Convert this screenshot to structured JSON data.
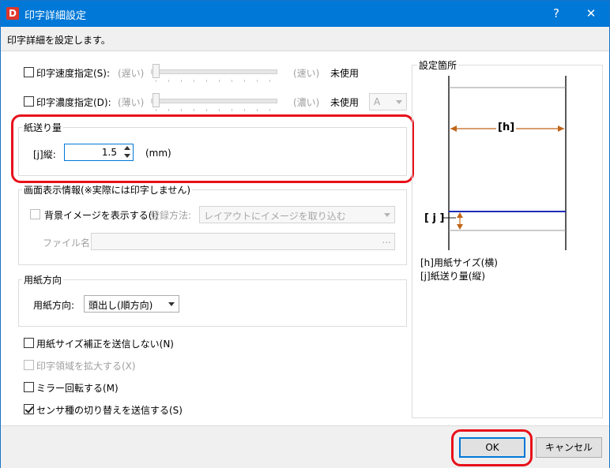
{
  "window": {
    "title": "印字詳細設定",
    "app_icon_letter": "D",
    "help_glyph": "?",
    "close_glyph": "✕",
    "description": "印字詳細を設定します。"
  },
  "speed": {
    "label": "印字速度指定(S):",
    "left_label": "(遅い)",
    "right_label": "(速い)",
    "status": "未使用",
    "checked": false
  },
  "density": {
    "label": "印字濃度指定(D):",
    "left_label": "(薄い)",
    "right_label": "(濃い)",
    "status": "未使用",
    "select_value": "A",
    "checked": false
  },
  "feed": {
    "group_title": "紙送り量",
    "field_label": "[j]縦:",
    "value": "1.5",
    "unit": "(mm)"
  },
  "screen_info": {
    "group_title": "画面表示情報(※実際には印字しません)",
    "bg_image_label": "背景イメージを表示する(I)",
    "register_label": "登録方法:",
    "register_value": "レイアウトにイメージを取り込む",
    "file_label": "ファイル名:",
    "file_value": "",
    "browse_label": "..."
  },
  "orientation": {
    "group_title": "用紙方向",
    "field_label": "用紙方向:",
    "value": "頭出し(順方向)"
  },
  "options": [
    {
      "label": "用紙サイズ補正を送信しない(N)",
      "checked": false,
      "disabled": false
    },
    {
      "label": "印字領域を拡大する(X)",
      "checked": false,
      "disabled": true
    },
    {
      "label": "ミラー回転する(M)",
      "checked": false,
      "disabled": false
    },
    {
      "label": "センサ種の切り替えを送信する(S)",
      "checked": true,
      "disabled": false
    }
  ],
  "diagram": {
    "group_title": "設定箇所",
    "h_label": "[h]",
    "j_label": "[ j ]",
    "legend_h": "[h]用紙サイズ(横)",
    "legend_j": "[j]紙送り量(縦)"
  },
  "buttons": {
    "ok": "OK",
    "cancel": "キャンセル"
  },
  "colors": {
    "title_bar": "#0078d7",
    "highlight_red": "#e8101a",
    "diagram_arrow": "#c0651a",
    "diagram_line": "#1f2cb8"
  }
}
